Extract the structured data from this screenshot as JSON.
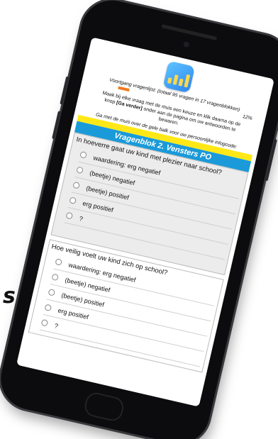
{
  "background": {
    "text_fragment": "s."
  },
  "header": {
    "progress_label": "Voortgang vragenlijst: (totaal 95 vragen in 17 vragenblokken)",
    "progress_percent_text": "12%",
    "progress_fraction": 0.12,
    "progress_color": "#f07a20",
    "instruction_line1": "Maak bij elke vraag met de muis een keuze en klik daarna op de",
    "instruction_pre": "knop ",
    "instruction_button": "[Ga verder]",
    "instruction_post": " onder aan de pagina om uw antwoorden te",
    "instruction_line3": "bewaren.",
    "login_hint": "Ga met de muis over de gele balk voor uw persoonlijke inlogcode:",
    "login_bar_color": "#ffe816"
  },
  "block": {
    "title": "Vragenblok 2. Vensters PO",
    "color": "#1a9ad9"
  },
  "questions": [
    {
      "text": "In hoeverre gaat uw kind met plezier naar school?",
      "options": [
        "waardering: erg negatief",
        "(beetje) negatief",
        "(beetje) positief",
        "erg positief",
        "?"
      ]
    },
    {
      "text": "Hoe veilig voelt uw kind zich op school?",
      "options": [
        "waardering: erg negatief",
        "(beetje) negatief",
        "(beetje) positief",
        "erg positief",
        "?"
      ]
    }
  ]
}
